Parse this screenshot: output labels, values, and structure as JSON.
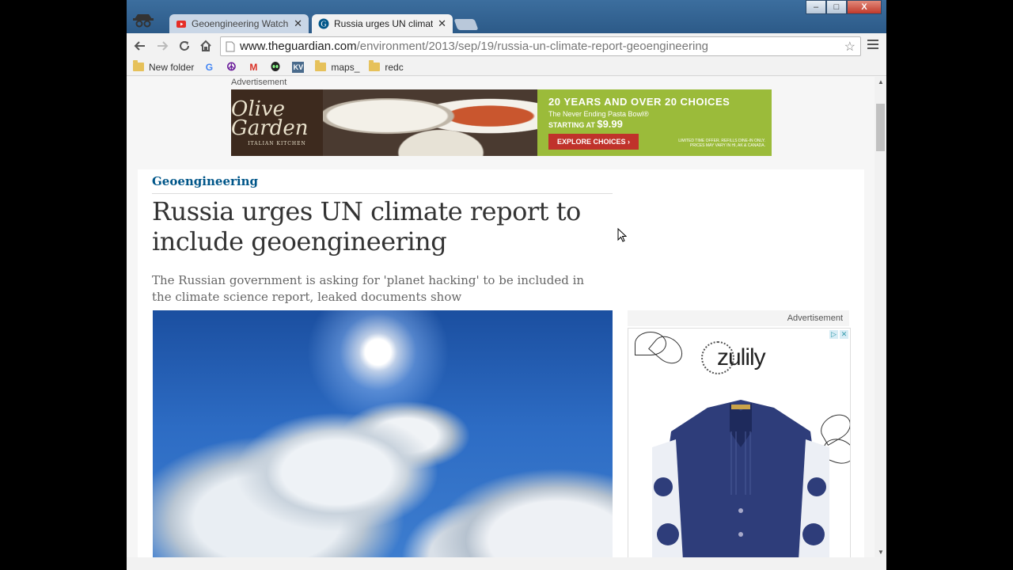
{
  "browser": {
    "tabs": [
      {
        "title": "Geoengineering Watch Gl",
        "active": false,
        "favicon": "youtube-icon"
      },
      {
        "title": "Russia urges UN climate r",
        "active": true,
        "favicon": "guardian-icon"
      }
    ],
    "window_controls": {
      "minimize": "–",
      "maximize": "□",
      "close": "X"
    },
    "url_host": "www.theguardian.com",
    "url_path": "/environment/2013/sep/19/russia-un-climate-report-geoengineering",
    "bookmarks": [
      {
        "label": "New folder",
        "icon": "folder-icon"
      },
      {
        "label": "",
        "icon": "google-icon"
      },
      {
        "label": "",
        "icon": "peace-icon"
      },
      {
        "label": "",
        "icon": "gmail-icon"
      },
      {
        "label": "",
        "icon": "alien-icon"
      },
      {
        "label": "",
        "icon": "kv-icon"
      },
      {
        "label": "maps_",
        "icon": "folder-icon"
      },
      {
        "label": "redc",
        "icon": "folder-icon"
      }
    ]
  },
  "page": {
    "ad_label": "Advertisement",
    "banner": {
      "brand_logo": "Olive Garden",
      "brand_sub": "ITALIAN KITCHEN",
      "headline": "20 YEARS AND OVER 20 CHOICES",
      "line1": "The Never Ending Pasta Bowl®",
      "line2_prefix": "STARTING AT",
      "price": "$9.99",
      "button": "EXPLORE CHOICES ›",
      "fine_print": "LIMITED TIME OFFER. REFILLS DINE-IN ONLY. PRICES MAY VARY IN HI, AK & CANADA."
    },
    "section": "Geoengineering",
    "headline": "Russia urges UN climate report to include geoengineering",
    "standfirst": "The Russian government is asking for 'planet hacking' to be included in the climate science report, leaked documents show",
    "side_ad": {
      "label": "Advertisement",
      "brand": "zulily"
    }
  }
}
